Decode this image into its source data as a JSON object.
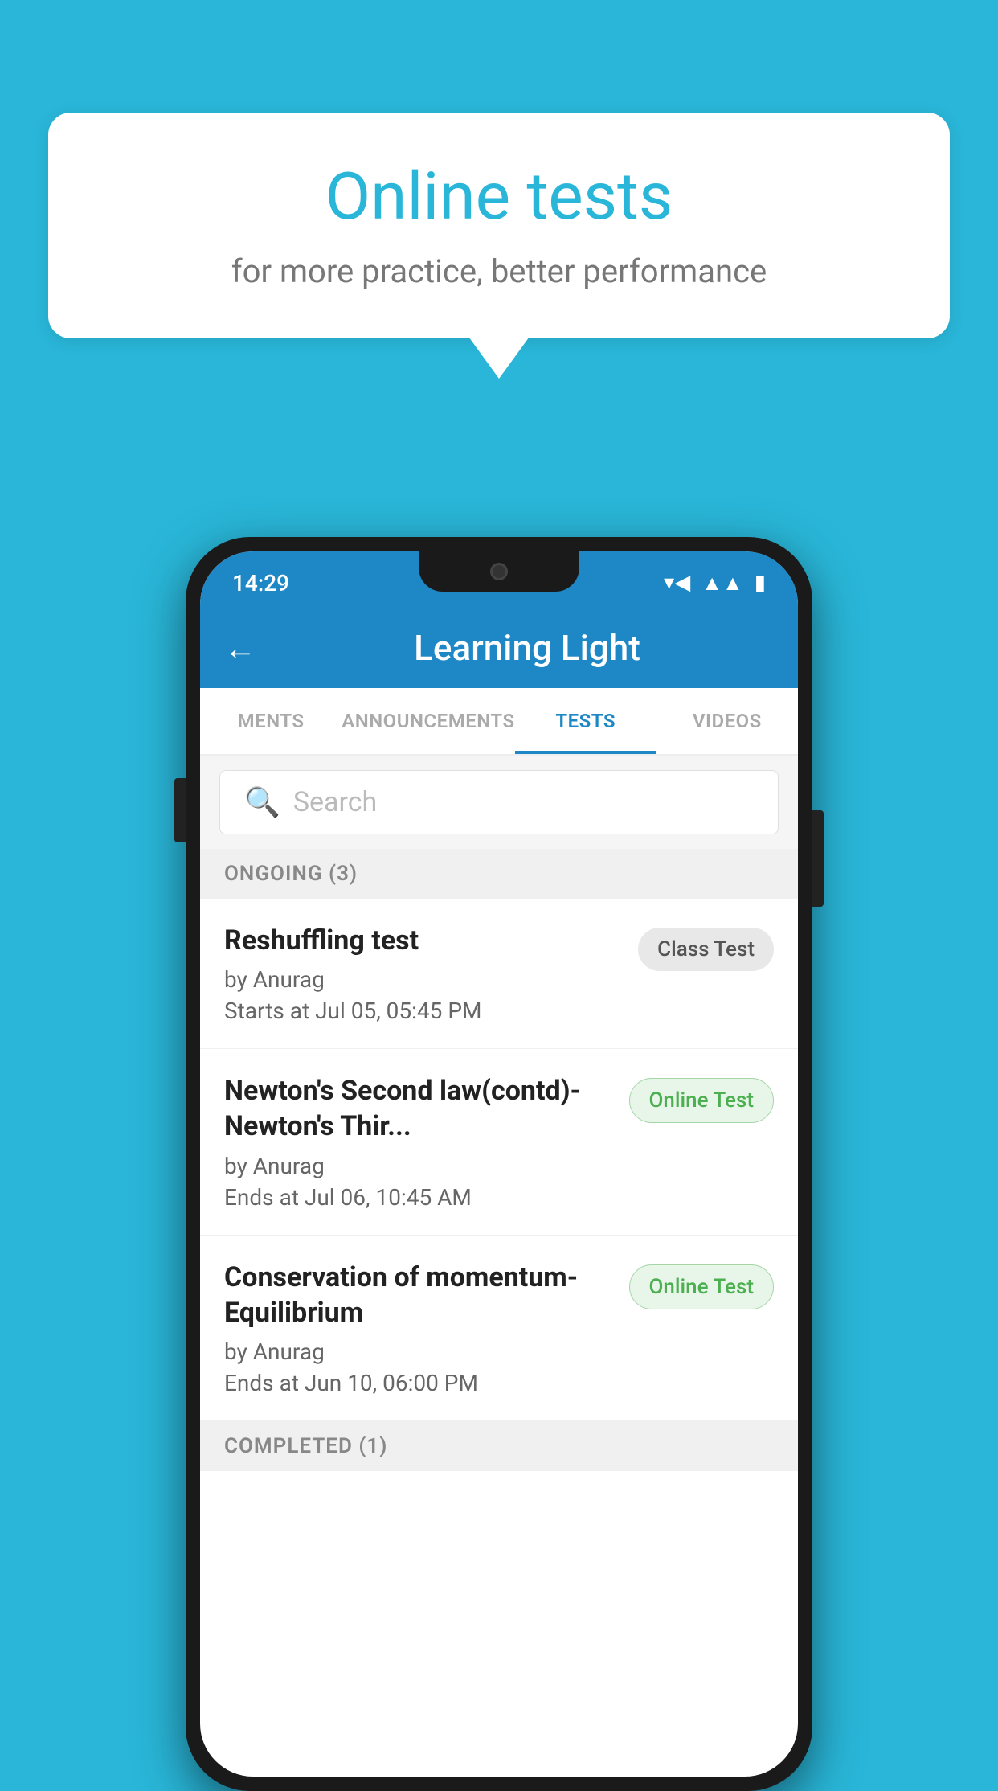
{
  "background_color": "#29b6d8",
  "speech_bubble": {
    "title": "Online tests",
    "subtitle": "for more practice, better performance"
  },
  "phone": {
    "status_bar": {
      "time": "14:29",
      "icons": {
        "wifi": "wifi",
        "signal": "signal",
        "battery": "battery"
      }
    },
    "app_bar": {
      "back_label": "←",
      "title": "Learning Light"
    },
    "tabs": [
      {
        "label": "MENTS",
        "active": false
      },
      {
        "label": "ANNOUNCEMENTS",
        "active": false
      },
      {
        "label": "TESTS",
        "active": true
      },
      {
        "label": "VIDEOS",
        "active": false
      }
    ],
    "search": {
      "placeholder": "Search"
    },
    "ongoing_section": {
      "title": "ONGOING (3)",
      "tests": [
        {
          "name": "Reshuffling test",
          "author": "by Anurag",
          "date": "Starts at  Jul 05, 05:45 PM",
          "badge": "Class Test",
          "badge_type": "class"
        },
        {
          "name": "Newton's Second law(contd)-Newton's Thir...",
          "author": "by Anurag",
          "date": "Ends at  Jul 06, 10:45 AM",
          "badge": "Online Test",
          "badge_type": "online"
        },
        {
          "name": "Conservation of momentum-Equilibrium",
          "author": "by Anurag",
          "date": "Ends at  Jun 10, 06:00 PM",
          "badge": "Online Test",
          "badge_type": "online"
        }
      ]
    },
    "completed_section": {
      "title": "COMPLETED (1)"
    }
  }
}
